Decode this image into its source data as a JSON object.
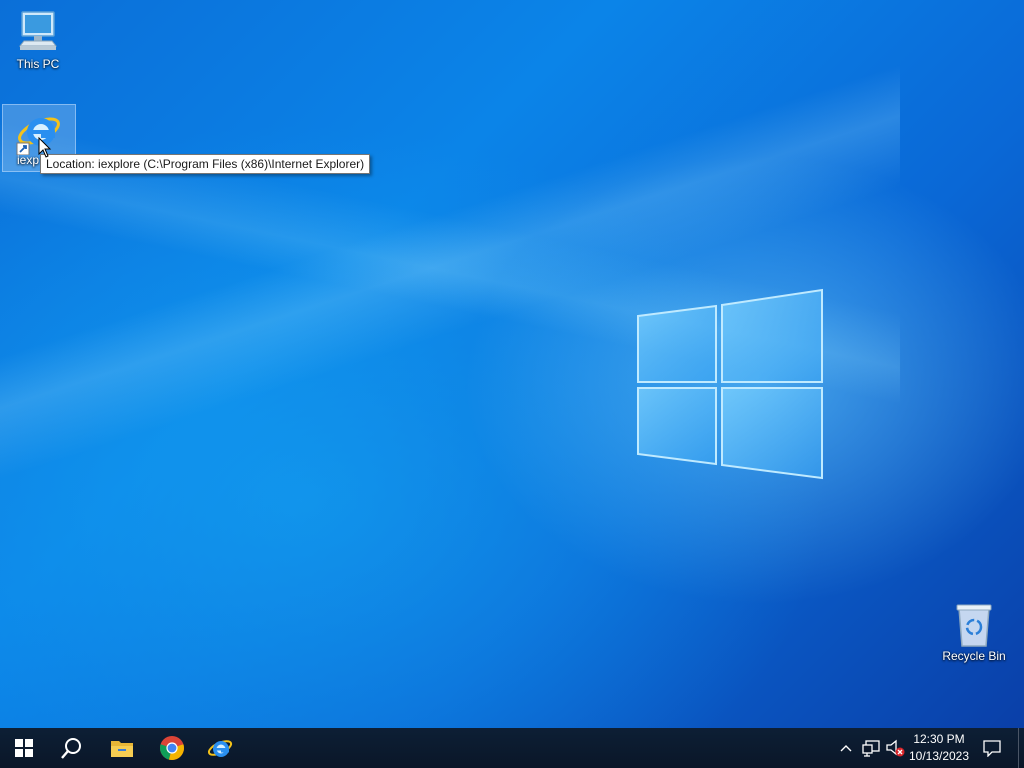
{
  "desktop": {
    "icons": [
      {
        "label": "This PC",
        "icon": "computer-icon"
      },
      {
        "label": "iexp",
        "icon": "internet-explorer-icon"
      },
      {
        "label": "Recycle Bin",
        "icon": "recycle-bin-icon"
      }
    ],
    "tooltip": "Location: iexplore (C:\\Program Files (x86)\\Internet Explorer)"
  },
  "taskbar": {
    "buttons": [
      {
        "icon": "windows-start-icon"
      },
      {
        "icon": "search-icon"
      },
      {
        "icon": "file-explorer-icon"
      },
      {
        "icon": "chrome-icon"
      },
      {
        "icon": "internet-explorer-icon"
      }
    ],
    "tray": {
      "icons": [
        "chevron-up-icon",
        "network-icon",
        "volume-muted-icon"
      ],
      "time": "12:30 PM",
      "date": "10/13/2023"
    },
    "action_center_icon": "notification-icon"
  },
  "colors": {
    "taskbar": "#0a1628",
    "desktop_accent": "#0b84e8",
    "tooltip_bg": "#ffffff"
  }
}
